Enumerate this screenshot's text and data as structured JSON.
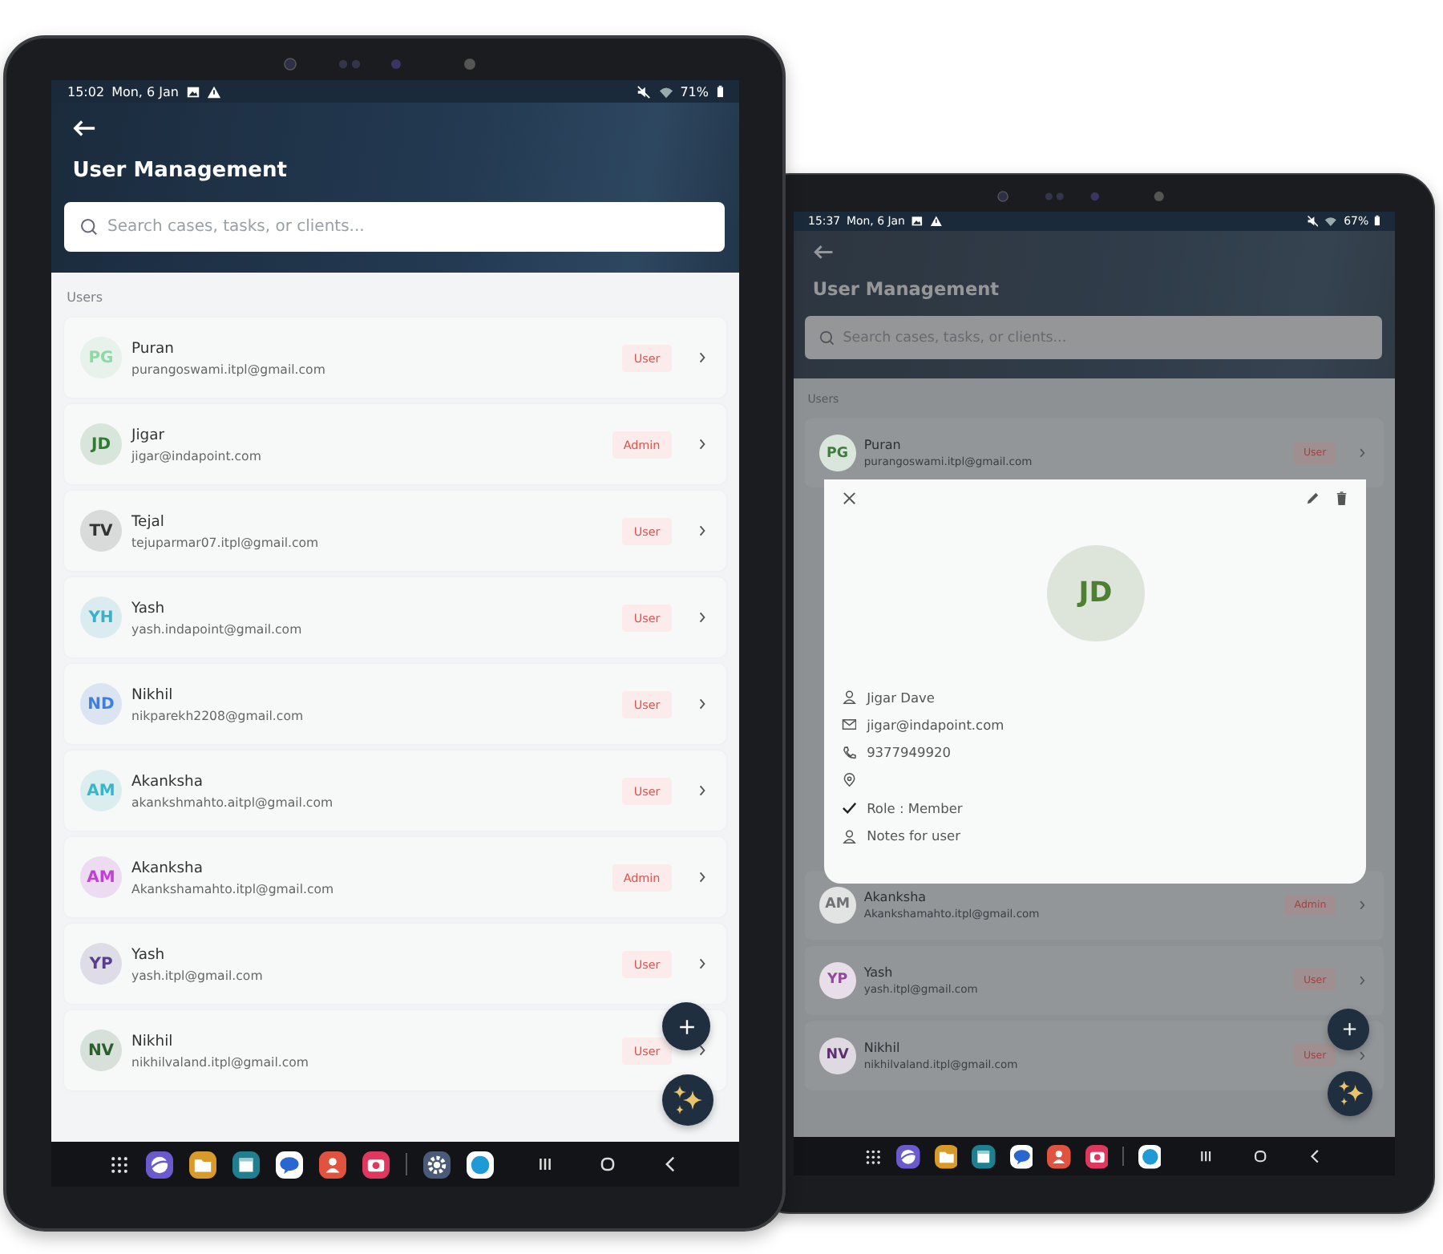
{
  "devices": [
    {
      "status_bar": {
        "time": "15:02",
        "date": "Mon, 6 Jan",
        "battery": "71%"
      },
      "header": {
        "title": "User Management"
      },
      "search": {
        "placeholder": "Search cases, tasks, or clients..."
      },
      "section_label": "Users",
      "users": [
        {
          "initials": "PG",
          "name": "Puran",
          "email": "purangoswami.itpl@gmail.com",
          "role": "User",
          "color": "#8fd9a8"
        },
        {
          "initials": "JD",
          "name": "Jigar",
          "email": "jigar@indapoint.com",
          "role": "Admin",
          "color": "#2e7d32"
        },
        {
          "initials": "TV",
          "name": "Tejal",
          "email": "tejuparmar07.itpl@gmail.com",
          "role": "User",
          "color": "#333333"
        },
        {
          "initials": "YH",
          "name": "Yash",
          "email": "yash.indapoint@gmail.com",
          "role": "User",
          "color": "#3bb0c9"
        },
        {
          "initials": "ND",
          "name": "Nikhil",
          "email": "nikparekh2208@gmail.com",
          "role": "User",
          "color": "#3f7fe0"
        },
        {
          "initials": "AM",
          "name": "Akanksha",
          "email": "akankshmahto.aitpl@gmail.com",
          "role": "User",
          "color": "#37b6c9"
        },
        {
          "initials": "AM",
          "name": "Akanksha",
          "email": "Akankshamahto.itpl@gmail.com",
          "role": "Admin",
          "color": "#c23fd6"
        },
        {
          "initials": "YP",
          "name": "Yash",
          "email": "yash.itpl@gmail.com",
          "role": "User",
          "color": "#5a3e8e"
        },
        {
          "initials": "NV",
          "name": "Nikhil",
          "email": "nikhilvaland.itpl@gmail.com",
          "role": "User",
          "color": "#2e5e2e"
        }
      ],
      "dock_apps": [
        {
          "kind": "browser",
          "color": "#6a5acd"
        },
        {
          "kind": "folder",
          "color": "#d89a2a"
        },
        {
          "kind": "calendar",
          "color": "#1f7f8f"
        },
        {
          "kind": "chat",
          "color": "#ffffff"
        },
        {
          "kind": "contacts",
          "color": "#e0533f"
        },
        {
          "kind": "camera",
          "color": "#e0375f"
        }
      ],
      "recent_apps": [
        {
          "kind": "settings",
          "color": "#4a5a78"
        },
        {
          "kind": "skype",
          "color": "#ffffff"
        }
      ]
    },
    {
      "status_bar": {
        "time": "15:37",
        "date": "Mon, 6 Jan",
        "battery": "67%"
      },
      "header": {
        "title": "User Management"
      },
      "search": {
        "placeholder": "Search cases, tasks, or clients..."
      },
      "section_label": "Users",
      "users": [
        {
          "initials": "PG",
          "name": "Puran",
          "email": "purangoswami.itpl@gmail.com",
          "role": "User",
          "color": "#3d7f3a"
        },
        {
          "initials": "AM",
          "name": "Akanksha",
          "email": "Akankshamahto.itpl@gmail.com",
          "role": "Admin",
          "color": "#6f7275"
        },
        {
          "initials": "YP",
          "name": "Yash",
          "email": "yash.itpl@gmail.com",
          "role": "User",
          "color": "#94489e"
        },
        {
          "initials": "NV",
          "name": "Nikhil",
          "email": "nikhilvaland.itpl@gmail.com",
          "role": "User",
          "color": "#5e2f6e"
        }
      ],
      "dock_apps": [
        {
          "kind": "browser",
          "color": "#6a5acd"
        },
        {
          "kind": "folder",
          "color": "#d89a2a"
        },
        {
          "kind": "calendar",
          "color": "#1f7f8f"
        },
        {
          "kind": "chat",
          "color": "#ffffff"
        },
        {
          "kind": "contacts",
          "color": "#e0533f"
        },
        {
          "kind": "camera",
          "color": "#e0375f"
        }
      ],
      "recent_apps": [
        {
          "kind": "skype",
          "color": "#ffffff"
        }
      ],
      "modal": {
        "initials": "JD",
        "color": "#4f7f32",
        "fields": [
          {
            "kind": "person",
            "text": "Jigar Dave"
          },
          {
            "kind": "email",
            "text": "jigar@indapoint.com"
          },
          {
            "kind": "phone",
            "text": "9377949920"
          },
          {
            "kind": "location"
          },
          {
            "kind": "check",
            "text": "Role : Member"
          },
          {
            "kind": "person",
            "text": "Notes for user"
          }
        ]
      }
    }
  ]
}
